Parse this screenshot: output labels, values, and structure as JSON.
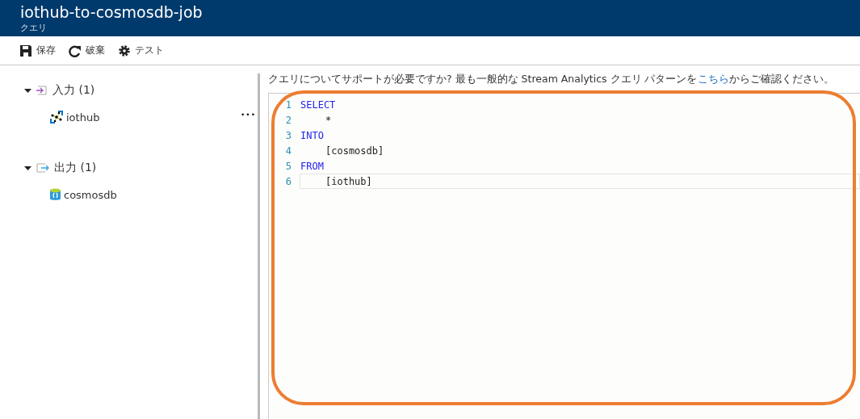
{
  "header": {
    "title": "iothub-to-cosmosdb-job",
    "subtitle": "クエリ"
  },
  "toolbar": [
    {
      "kind": "save",
      "label": "保存"
    },
    {
      "kind": "discard",
      "label": "破棄"
    },
    {
      "kind": "test",
      "label": "テスト"
    }
  ],
  "tree": [
    {
      "kind": "input",
      "label": "入力 (1)",
      "expanded": true,
      "children": [
        {
          "kind": "iothub",
          "label": "iothub",
          "more": "•••"
        }
      ]
    },
    {
      "kind": "output",
      "label": "出力 (1)",
      "expanded": true,
      "children": [
        {
          "kind": "cosmosdb",
          "label": "cosmosdb"
        }
      ]
    }
  ],
  "help": {
    "before": "クエリについてサポートが必要ですか? 最も一般的な Stream Analytics クエリ パターンを",
    "link": "こちら",
    "after": "からご確認ください。"
  },
  "editor": {
    "lines": [
      {
        "number": "1",
        "text": "SELECT",
        "kind": "keyword",
        "indent": false,
        "current": false
      },
      {
        "number": "2",
        "text": "*",
        "kind": "plain",
        "indent": true,
        "current": false
      },
      {
        "number": "3",
        "text": "INTO",
        "kind": "keyword",
        "indent": false,
        "current": false
      },
      {
        "number": "4",
        "text": "[cosmosdb]",
        "kind": "plain",
        "indent": true,
        "current": false
      },
      {
        "number": "5",
        "text": "FROM",
        "kind": "keyword",
        "indent": false,
        "current": false
      },
      {
        "number": "6",
        "text": "[iothub]",
        "kind": "plain",
        "indent": true,
        "current": true
      }
    ],
    "highlighted": true
  }
}
